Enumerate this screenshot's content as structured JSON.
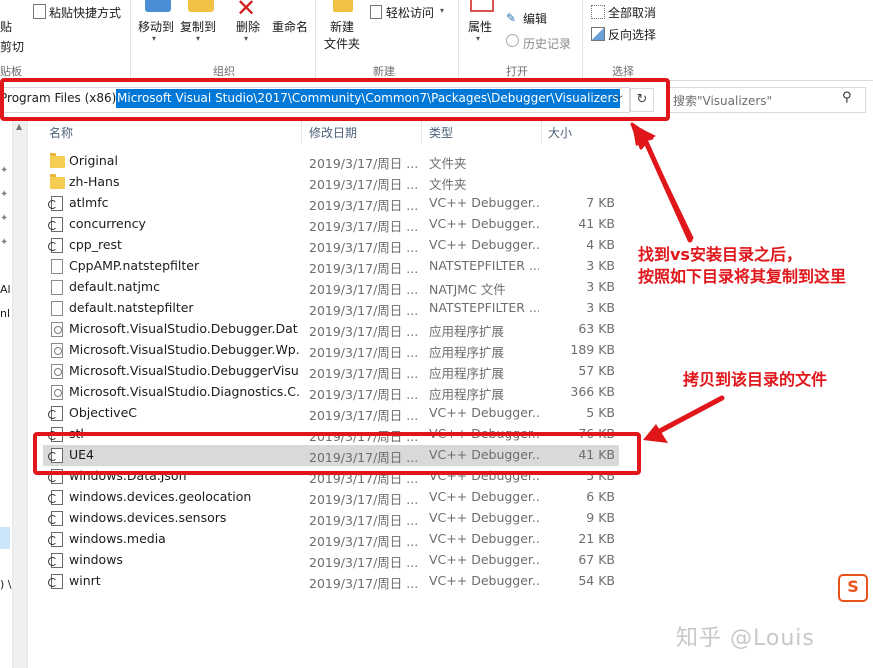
{
  "ribbon": {
    "clipboard": {
      "paste_shortcut": "粘贴快捷方式",
      "paste": "贴",
      "cut": "剪切",
      "group": "贴板"
    },
    "organize": {
      "move_to": "移动到",
      "copy_to": "复制到",
      "delete": "删除",
      "rename": "重命名",
      "group": "组织"
    },
    "new": {
      "new_folder_line1": "新建",
      "new_folder_line2": "文件夹",
      "easy_access": "轻松访问",
      "group": "新建"
    },
    "open": {
      "properties": "属性",
      "edit": "编辑",
      "history": "历史记录",
      "group": "打开"
    },
    "select": {
      "select_all": "全部取消",
      "invert": "反向选择",
      "group": "选择"
    }
  },
  "address": {
    "prefix": "Program Files (x86)\\",
    "selected": "Microsoft Visual Studio\\2017\\Community\\Common7\\Packages\\Debugger\\Visualizers"
  },
  "search": {
    "placeholder": "搜索\"Visualizers\""
  },
  "nav": {
    "partial_1": "Al",
    "partial_2": "nl",
    "partial_3": ") \\"
  },
  "columns": {
    "name": "名称",
    "date": "修改日期",
    "type": "类型",
    "size": "大小"
  },
  "files": [
    {
      "icon": "folder-icon",
      "name": "Original",
      "date": "2019/3/17/周日 ...",
      "type": "文件夹",
      "size": ""
    },
    {
      "icon": "folder-icon",
      "name": "zh-Hans",
      "date": "2019/3/17/周日 ...",
      "type": "文件夹",
      "size": ""
    },
    {
      "icon": "natvis-file-icon",
      "name": "atlmfc",
      "date": "2019/3/17/周日 ...",
      "type": "VC++ Debugger...",
      "size": "7 KB"
    },
    {
      "icon": "natvis-file-icon",
      "name": "concurrency",
      "date": "2019/3/17/周日 ...",
      "type": "VC++ Debugger...",
      "size": "41 KB"
    },
    {
      "icon": "natvis-file-icon",
      "name": "cpp_rest",
      "date": "2019/3/17/周日 ...",
      "type": "VC++ Debugger...",
      "size": "4 KB"
    },
    {
      "icon": "file-icon",
      "name": "CppAMP.natstepfilter",
      "date": "2019/3/17/周日 ...",
      "type": "NATSTEPFILTER ...",
      "size": "3 KB"
    },
    {
      "icon": "file-icon",
      "name": "default.natjmc",
      "date": "2019/3/17/周日 ...",
      "type": "NATJMC 文件",
      "size": "3 KB"
    },
    {
      "icon": "file-icon",
      "name": "default.natstepfilter",
      "date": "2019/3/17/周日 ...",
      "type": "NATSTEPFILTER ...",
      "size": "3 KB"
    },
    {
      "icon": "dll-file-icon",
      "name": "Microsoft.VisualStudio.Debugger.Dat...",
      "date": "2019/3/17/周日 ...",
      "type": "应用程序扩展",
      "size": "63 KB"
    },
    {
      "icon": "dll-file-icon",
      "name": "Microsoft.VisualStudio.Debugger.Wp...",
      "date": "2019/3/17/周日 ...",
      "type": "应用程序扩展",
      "size": "189 KB"
    },
    {
      "icon": "dll-file-icon",
      "name": "Microsoft.VisualStudio.DebuggerVisu...",
      "date": "2019/3/17/周日 ...",
      "type": "应用程序扩展",
      "size": "57 KB"
    },
    {
      "icon": "dll-file-icon",
      "name": "Microsoft.VisualStudio.Diagnostics.C...",
      "date": "2019/3/17/周日 ...",
      "type": "应用程序扩展",
      "size": "366 KB"
    },
    {
      "icon": "natvis-file-icon",
      "name": "ObjectiveC",
      "date": "2019/3/17/周日 ...",
      "type": "VC++ Debugger...",
      "size": "5 KB"
    },
    {
      "icon": "natvis-file-icon",
      "name": "stl",
      "date": "2019/3/17/周日 ...",
      "type": "VC++ Debugger...",
      "size": "76 KB"
    },
    {
      "icon": "natvis-file-icon",
      "name": "UE4",
      "date": "2019/3/17/周日 ...",
      "type": "VC++ Debugger...",
      "size": "41 KB",
      "highlighted": true
    },
    {
      "icon": "natvis-file-icon",
      "name": "windows.Data.Json",
      "date": "2019/3/17/周日 ...",
      "type": "VC++ Debugger...",
      "size": "5 KB"
    },
    {
      "icon": "natvis-file-icon",
      "name": "windows.devices.geolocation",
      "date": "2019/3/17/周日 ...",
      "type": "VC++ Debugger...",
      "size": "6 KB"
    },
    {
      "icon": "natvis-file-icon",
      "name": "windows.devices.sensors",
      "date": "2019/3/17/周日 ...",
      "type": "VC++ Debugger...",
      "size": "9 KB"
    },
    {
      "icon": "natvis-file-icon",
      "name": "windows.media",
      "date": "2019/3/17/周日 ...",
      "type": "VC++ Debugger...",
      "size": "21 KB"
    },
    {
      "icon": "natvis-file-icon",
      "name": "windows",
      "date": "2019/3/17/周日 ...",
      "type": "VC++ Debugger...",
      "size": "67 KB"
    },
    {
      "icon": "natvis-file-icon",
      "name": "winrt",
      "date": "2019/3/17/周日 ...",
      "type": "VC++ Debugger...",
      "size": "54 KB"
    }
  ],
  "annotations": {
    "note1_line1": "找到vs安装目录之后，",
    "note1_line2": "按照如下目录将其复制到这里",
    "note2": "拷贝到该目录的文件"
  },
  "watermark": {
    "text": "知乎 @Louis",
    "logo": "S"
  },
  "colors": {
    "annotation_red": "#e0161b",
    "selection_blue": "#0078d7",
    "folder_yellow": "#f5cd53"
  }
}
